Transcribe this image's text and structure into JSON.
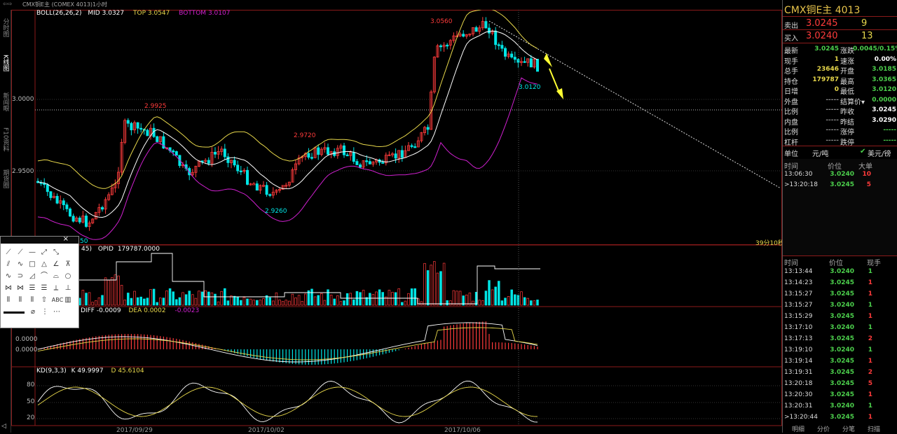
{
  "window": {
    "title": "CMX铜E主 (COMEX 4013)1小时"
  },
  "left_tabs": [
    {
      "label": "分时图",
      "active": false
    },
    {
      "label": "K线图",
      "active": true
    },
    {
      "label": "新闻眼",
      "active": false
    },
    {
      "label": "F10资料",
      "active": false
    },
    {
      "label": "期货圈",
      "active": false
    }
  ],
  "main_indicator": {
    "name": "BOLL(26,26,2)",
    "mid_label": "MID",
    "mid_value": "3.0327",
    "top_label": "TOP",
    "top_value": "3.0547",
    "bottom_label": "BOTTOM",
    "bottom_value": "3.0107"
  },
  "price_axis": {
    "labels": [
      "3.0000",
      "2.9500"
    ]
  },
  "annotations": {
    "high_label": "3.0560",
    "low_label": "3.0120",
    "mark_2_9925": "2.9925",
    "mark_2_9720": "2.9720",
    "mark_2_9260": "2.9260",
    "partial_left": "50",
    "countdown": "39分10秒"
  },
  "volume_panel": {
    "label_left": "45)",
    "opid_label": "OPID",
    "opid_value": "179787.0000"
  },
  "macd_panel": {
    "diff_label": "DIFF",
    "diff_value": "-0.0009",
    "dea_label": "DEA",
    "dea_value": "0.0002",
    "macd_value": "-0.0023",
    "axis": [
      "0.0000",
      "0.0000"
    ]
  },
  "kd_panel": {
    "name": "KD(9,3,3)",
    "k_label": "K",
    "k_value": "49.9997",
    "d_label": "D",
    "d_value": "45.6104",
    "axis": [
      "80",
      "50",
      "20"
    ]
  },
  "date_labels": [
    "2017/09/29",
    "2017/10/02",
    "2017/10/06"
  ],
  "right_panel": {
    "title": "CMX铜E主  4013",
    "sell_label": "卖出",
    "sell_price": "3.0245",
    "sell_qty": "9",
    "buy_label": "买入",
    "buy_price": "3.0240",
    "buy_qty": "13",
    "quote_rows": [
      {
        "l1": "最新",
        "v1": "3.0245",
        "c1": "#4cd04c",
        "l2": "涨跌",
        "v2": "0.0045/0.15%",
        "c2": "#4cd04c"
      },
      {
        "l1": "现手",
        "v1": "1",
        "c1": "#e8d84b",
        "l2": "速涨",
        "v2": "0.00%",
        "c2": "#ffffff"
      },
      {
        "l1": "总手",
        "v1": "23646",
        "c1": "#e8d84b",
        "l2": "开盘",
        "v2": "3.0185",
        "c2": "#4cd04c"
      },
      {
        "l1": "持仓",
        "v1": "179787",
        "c1": "#e8d84b",
        "l2": "最高",
        "v2": "3.0365",
        "c2": "#4cd04c"
      },
      {
        "l1": "日增",
        "v1": "0",
        "c1": "#e8d84b",
        "l2": "最低",
        "v2": "3.0120",
        "c2": "#4cd04c"
      },
      {
        "l1": "外盘",
        "v1": "-----",
        "c1": "#888",
        "l2": "结算价▾",
        "v2": "0.0000",
        "c2": "#4cd04c"
      },
      {
        "l1": "比例",
        "v1": "-----",
        "c1": "#888",
        "l2": "昨收",
        "v2": "3.0245",
        "c2": "#ffffff"
      },
      {
        "l1": "内盘",
        "v1": "-----",
        "c1": "#888",
        "l2": "昨结",
        "v2": "3.0290",
        "c2": "#ffffff"
      },
      {
        "l1": "比例",
        "v1": "-----",
        "c1": "#888",
        "l2": "涨停",
        "v2": "-----",
        "c2": "#4cd04c"
      },
      {
        "l1": "杠杆",
        "v1": "-----",
        "c1": "#888",
        "l2": "跌停",
        "v2": "-----",
        "c2": "#4cd04c"
      }
    ],
    "unit_label": "单位",
    "unit_value": "元/吨",
    "currency": "美元/镑",
    "big_header": {
      "time": "时间",
      "price": "价位",
      "big": "大单"
    },
    "big_rows": [
      {
        "time": "13:06:30",
        "price": "3.0240",
        "qty": "10"
      },
      {
        "time": ">13:20:18",
        "price": "3.0245",
        "qty": "5"
      }
    ],
    "tick_header": {
      "time": "时间",
      "price": "价位",
      "qty": "现手"
    },
    "tick_rows": [
      {
        "time": "13:13:44",
        "price": "3.0240",
        "qty": "1",
        "qc": "#4cd04c"
      },
      {
        "time": "13:14:23",
        "price": "3.0245",
        "qty": "1",
        "qc": "#ff3b3b"
      },
      {
        "time": "13:15:27",
        "price": "3.0245",
        "qty": "1",
        "qc": "#ff3b3b"
      },
      {
        "time": "13:15:27",
        "price": "3.0240",
        "qty": "1",
        "qc": "#4cd04c"
      },
      {
        "time": "13:15:29",
        "price": "3.0245",
        "qty": "1",
        "qc": "#ff3b3b"
      },
      {
        "time": "13:17:10",
        "price": "3.0240",
        "qty": "1",
        "qc": "#4cd04c"
      },
      {
        "time": "13:17:13",
        "price": "3.0245",
        "qty": "2",
        "qc": "#ff3b3b"
      },
      {
        "time": "13:19:10",
        "price": "3.0240",
        "qty": "1",
        "qc": "#4cd04c"
      },
      {
        "time": "13:19:14",
        "price": "3.0245",
        "qty": "1",
        "qc": "#ff3b3b"
      },
      {
        "time": "13:19:31",
        "price": "3.0245",
        "qty": "2",
        "qc": "#ff3b3b"
      },
      {
        "time": "13:20:18",
        "price": "3.0245",
        "qty": "5",
        "qc": "#ff3b3b"
      },
      {
        "time": "13:20:30",
        "price": "3.0245",
        "qty": "1",
        "qc": "#ff3b3b"
      },
      {
        "time": "13:20:31",
        "price": "3.0240",
        "qty": "1",
        "qc": "#4cd04c"
      },
      {
        "time": ">13:20:44",
        "price": "3.0245",
        "qty": "1",
        "qc": "#ff3b3b"
      }
    ],
    "bottom_tabs": [
      "明细",
      "分价",
      "分笔",
      "扫描"
    ]
  },
  "toolbox": {
    "close": "×",
    "abc": "ABC"
  },
  "colors": {
    "up": "#ff3b3b",
    "down": "#00e5e5",
    "mid": "#ffffff",
    "top": "#e8d84b",
    "bottom": "#d020d0",
    "k": "#ffffff",
    "d": "#e8d84b"
  }
}
